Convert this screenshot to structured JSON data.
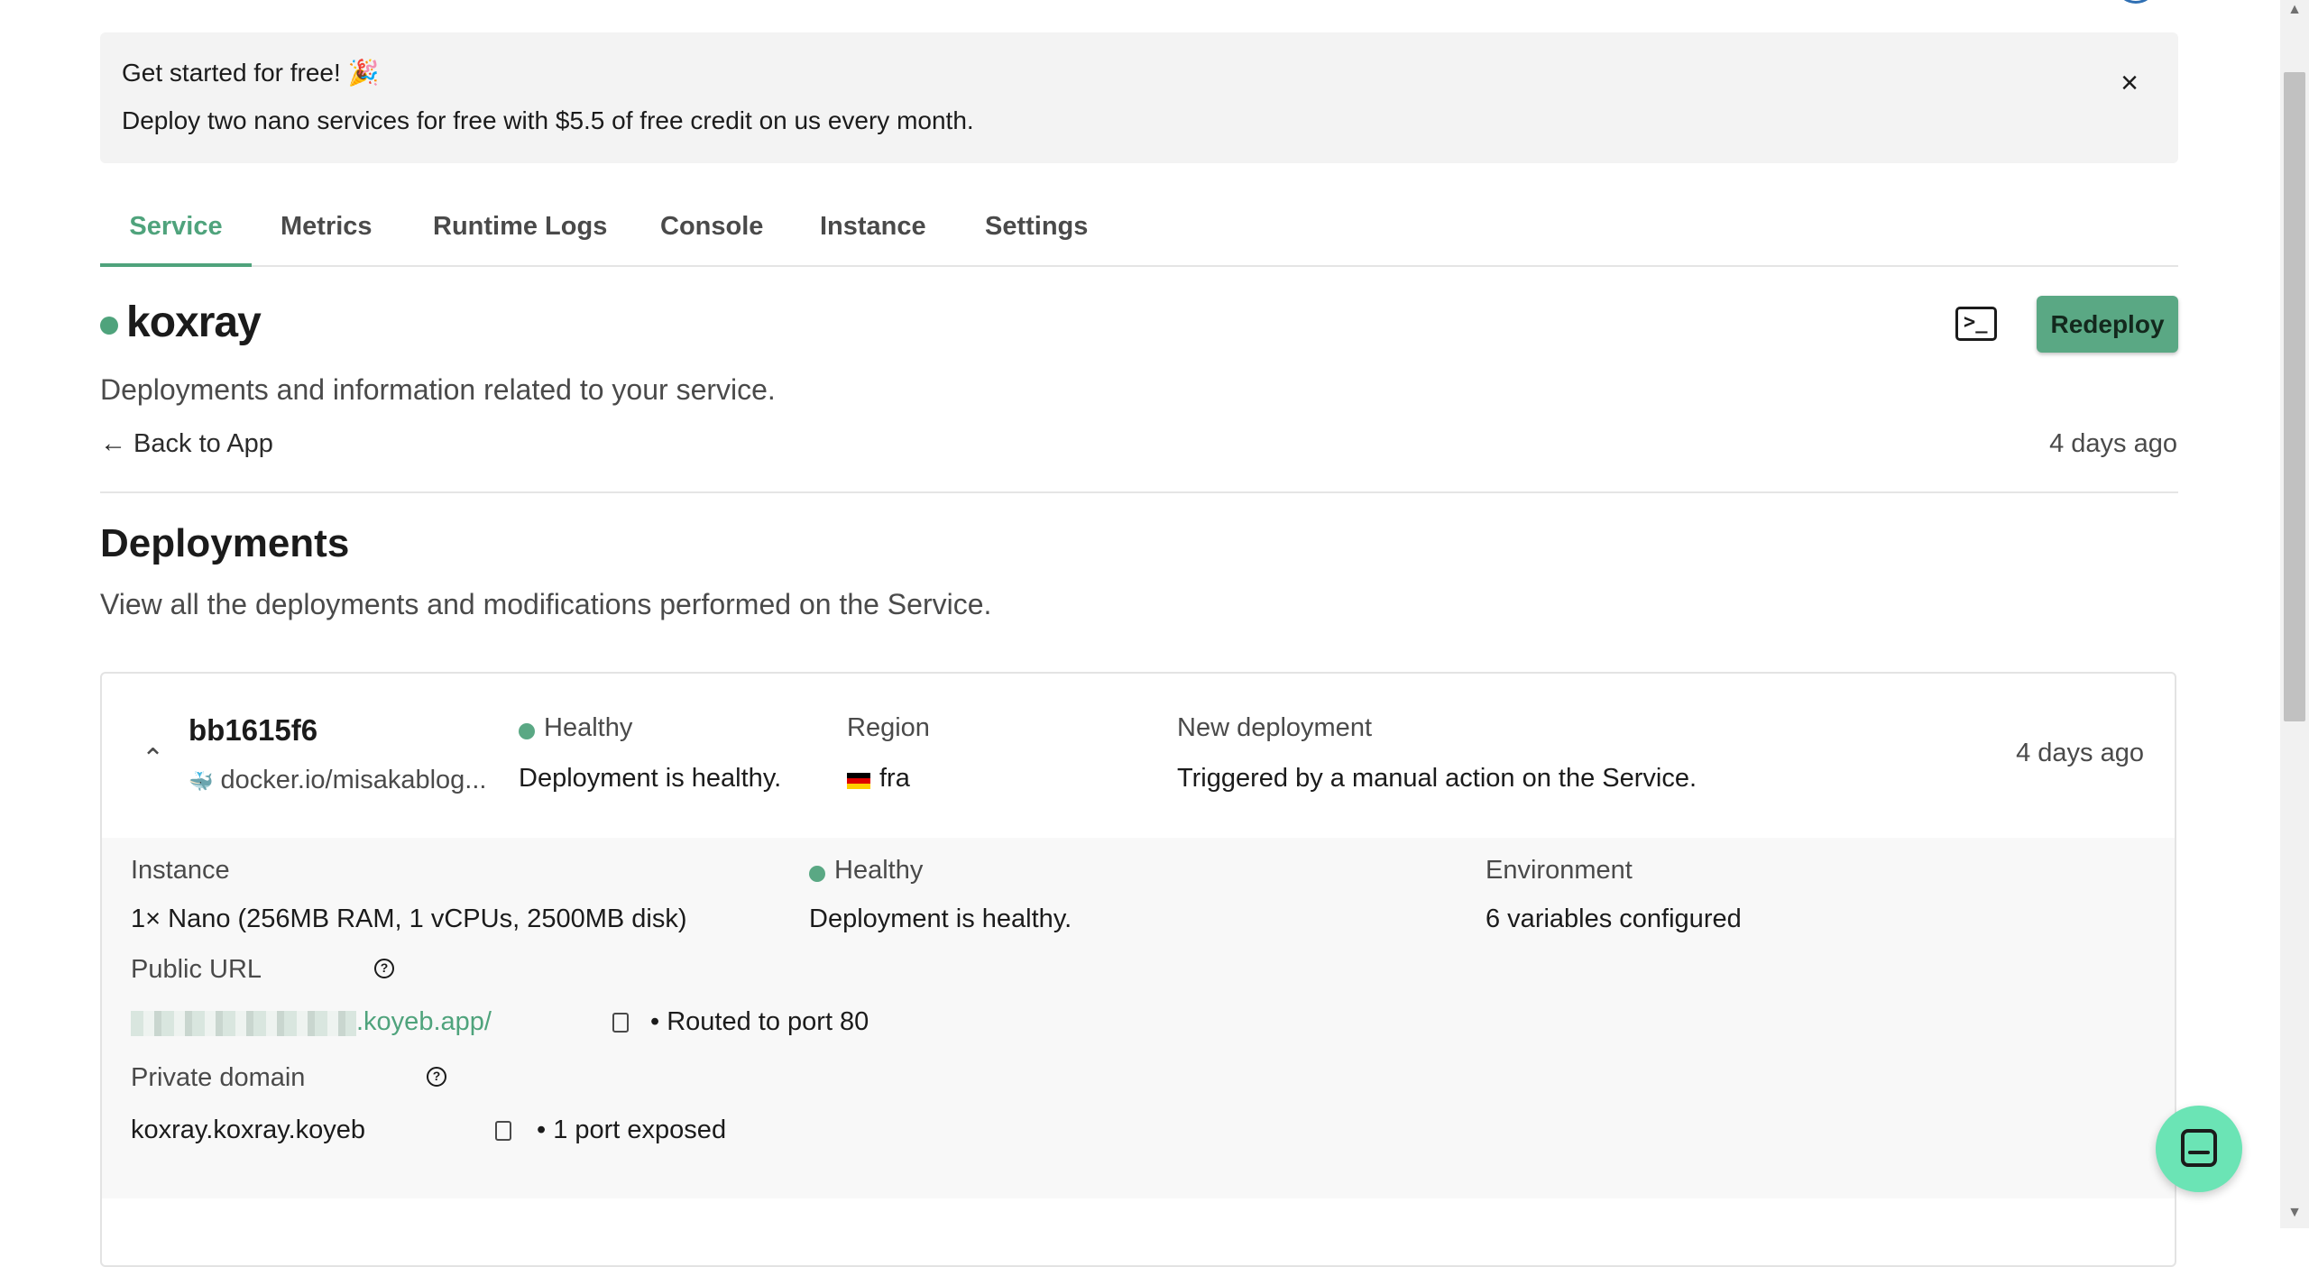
{
  "banner": {
    "title": "Get started for free! 🎉",
    "text": "Deploy two nano services for free with $5.5 of free credit on us every month.",
    "close_icon": "×"
  },
  "tabs": [
    {
      "label": "Service",
      "active": true
    },
    {
      "label": "Metrics"
    },
    {
      "label": "Runtime Logs"
    },
    {
      "label": "Console"
    },
    {
      "label": "Instance"
    },
    {
      "label": "Settings"
    }
  ],
  "service": {
    "name": "koxray",
    "description": "Deployments and information related to your service.",
    "back_label": "← Back to App",
    "age": "4 days ago",
    "redeploy_label": "Redeploy",
    "status_color": "#4fa37c"
  },
  "deployments": {
    "title": "Deployments",
    "subtitle": "View all the deployments and modifications performed on the Service.",
    "items": [
      {
        "hash": "bb1615f6",
        "image": "docker.io/misakablog...",
        "status": "Healthy",
        "status_detail": "Deployment is healthy.",
        "region_label": "Region",
        "region": "fra",
        "trigger_title": "New deployment",
        "trigger_detail": "Triggered by a manual action on the Service.",
        "age": "4 days ago",
        "details": {
          "instance_label": "Instance",
          "instance_value": "1× Nano (256MB RAM, 1 vCPUs, 2500MB disk)",
          "health_label": "Healthy",
          "health_value": "Deployment is healthy.",
          "env_label": "Environment",
          "env_value": "6 variables configured",
          "public_url_label": "Public URL",
          "public_url_suffix": ".koyeb.app/",
          "routed": "• Routed to port 80",
          "private_domain_label": "Private domain",
          "private_domain": "koxray.koxray.koyeb",
          "ports": "• 1 port exposed"
        }
      }
    ]
  },
  "colors": {
    "accent": "#4fa37c",
    "chat_button": "#6be4b5"
  }
}
